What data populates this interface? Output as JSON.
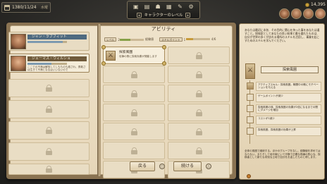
{
  "top": {
    "date": "1380/11/24",
    "weekday": "水曜",
    "menu_title": "キャラクターのレベル",
    "menu_icons": [
      "inventory-icon",
      "book-icon",
      "party-icon",
      "map-icon",
      "journal-icon",
      "settings-icon"
    ],
    "money": "14,395"
  },
  "characters": [
    {
      "name": "ジャン・ラブフィット",
      "bar": 0.9,
      "desc": ""
    },
    {
      "name": "ジェーマス・ウィルショ",
      "bar": 0.6,
      "desc": "ここでの不満は解放してしもものも癒され、勇敢さは生きて不満となるはいいないので"
    }
  ],
  "empty_char_slots": 6,
  "abilities": {
    "title": "アビリティ",
    "stat1_label": "レベル",
    "stat1_value": "2",
    "stat1_fill": 0.45,
    "stat1_tag": "経験値",
    "stat2_label": "スキルポイント",
    "stat2_value": "1",
    "stat2_fill": 0.3,
    "stat2_tag": "ネクストレベル",
    "stat2_max": "4/6",
    "active": {
      "label": "探索風圏",
      "sub": "攻撃の際に探索効果が発動します"
    },
    "locked_cells": 13
  },
  "buttons": {
    "back": "戻る",
    "next": "続ける",
    "back_hint": "○",
    "next_hint": "△"
  },
  "info": {
    "text": "あなたは最初に本気、その目的に関心を持った事をあなたは通すこと。探検家としてあなたの良い結果と最も優れたものは、自分が世界の多くが訪れる場所のスキルを活用し、事業を起こすためのスキルを学んでください。",
    "header": "探索風圏",
    "items": [
      "アクティブスキル：探索風圏。戦闘中の敵にモチベーションを与える",
      "ゲームポイントが減少",
      "探索風圏の味、探索風圏の効果が2倍になるまでの間にダメージを増加",
      "コストが1減少",
      "探索風圏、探索風圏の効果が上昇"
    ],
    "bottom": "全体の風圏で継続する。ほかのグループをなし。経験値を求めてはならない。またそして地平線にいて冷静で正確な熟練の熱心な、探検者として新たな未知な土地で自分をお返したものと称します。"
  }
}
